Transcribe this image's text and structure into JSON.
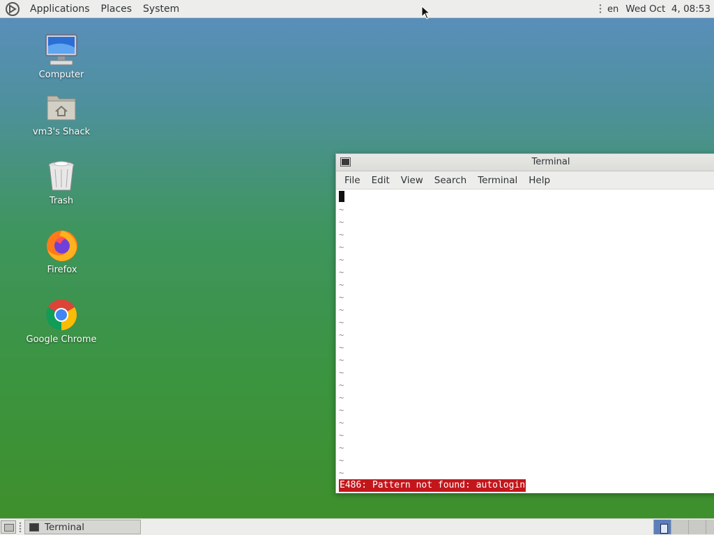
{
  "top_panel": {
    "menus": [
      "Applications",
      "Places",
      "System"
    ],
    "language": "en",
    "clock": "Wed Oct  4, 08:53"
  },
  "desktop": {
    "icons": [
      {
        "label": "Computer",
        "icon": "computer-icon"
      },
      {
        "label": "vm3's Shack",
        "icon": "home-folder-icon"
      },
      {
        "label": "Trash",
        "icon": "trash-icon"
      },
      {
        "label": "Firefox",
        "icon": "firefox-icon"
      },
      {
        "label": "Google Chrome",
        "icon": "chrome-icon"
      }
    ]
  },
  "terminal": {
    "title": "Terminal",
    "menus": [
      "File",
      "Edit",
      "View",
      "Search",
      "Terminal",
      "Help"
    ],
    "tilde": "~",
    "error": "E486: Pattern not found: autologin"
  },
  "taskbar": {
    "task_label": "Terminal"
  },
  "colors": {
    "error_bg": "#c3161b",
    "panel_bg": "#ededeb",
    "workspace_active": "#5d7fb9"
  }
}
